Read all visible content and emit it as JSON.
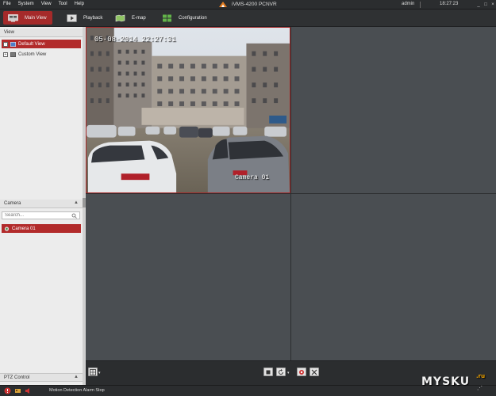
{
  "menu": [
    "File",
    "System",
    "View",
    "Tool",
    "Help"
  ],
  "app_title": "iVMS-4200  PCNVR",
  "user": "admin",
  "clock": "18:27:23",
  "window_controls": [
    "_",
    "□",
    "×"
  ],
  "tabs": [
    {
      "label": "Main View",
      "icon": "monitor-icon",
      "active": true
    },
    {
      "label": "Playback",
      "icon": "film-icon",
      "active": false
    },
    {
      "label": "E-map",
      "icon": "map-icon",
      "active": false
    },
    {
      "label": "Configuration",
      "icon": "grid-config-icon",
      "active": false
    }
  ],
  "view_panel": {
    "title": "View",
    "items": [
      {
        "label": "Default View",
        "expander": "-",
        "selected": true
      },
      {
        "label": "Custom View",
        "expander": "+",
        "selected": false
      }
    ]
  },
  "camera_panel": {
    "title": "Camera",
    "search_placeholder": "Search...",
    "items": [
      {
        "label": "Camera 01",
        "selected": true
      }
    ]
  },
  "ptz_panel": {
    "title": "PTZ Control"
  },
  "video": {
    "timestamp": "05-08-2014 22:27:31",
    "camera_name": "Camera 01"
  },
  "status_bar": {
    "text": "Motion Detection Alarm Stop"
  },
  "watermark": {
    "main": "MYSKU",
    "suffix": ".ru"
  },
  "colors": {
    "accent": "#a52a2a",
    "panel_bg": "#ececec",
    "dark_bg": "#2b2d2f",
    "cell_bg": "#4a4e52"
  }
}
